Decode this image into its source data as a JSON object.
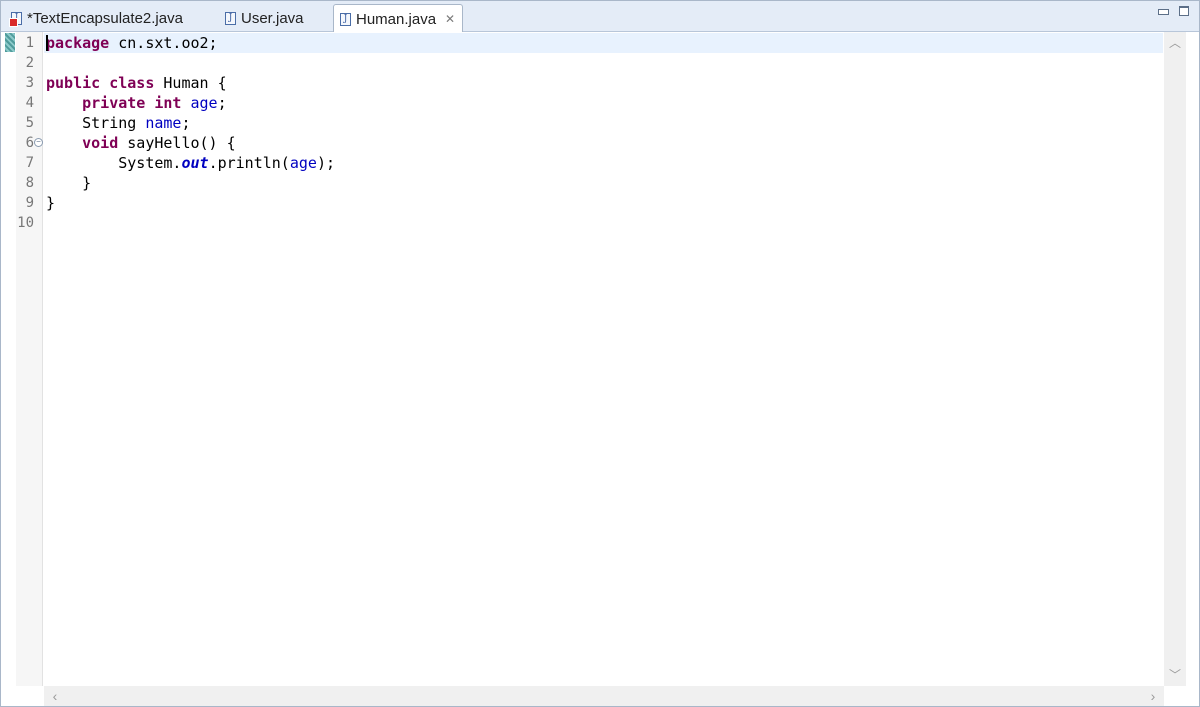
{
  "tabs": [
    {
      "label": "*TextEncapsulate2.java",
      "icon": "java-file-error-icon",
      "active": false
    },
    {
      "label": "User.java",
      "icon": "java-file-icon",
      "active": false
    },
    {
      "label": "Human.java",
      "icon": "java-file-icon",
      "active": true
    }
  ],
  "line_numbers": [
    "1",
    "2",
    "3",
    "4",
    "5",
    "6",
    "7",
    "8",
    "9",
    "10"
  ],
  "code": {
    "l1": {
      "kw": "package",
      "rest": " cn.sxt.oo2;"
    },
    "l3": {
      "kw1": "public",
      "kw2": "class",
      "rest": " Human {"
    },
    "l4": {
      "kw1": "private",
      "kw2": "int",
      "field": "age",
      "rest": ";"
    },
    "l5": {
      "type": "String ",
      "field": "name",
      "rest": ";"
    },
    "l6": {
      "kw": "void",
      "rest": " sayHello() {"
    },
    "l7": {
      "cls": "System.",
      "sfield": "out",
      "call": ".println(",
      "field": "age",
      "rest": ");"
    },
    "l8": {
      "text": "}"
    },
    "l9": {
      "text": "}"
    }
  },
  "icons": {
    "close": "close-icon",
    "fold": "fold-collapse-icon",
    "minimize": "minimize-icon",
    "maximize": "maximize-icon",
    "scroll_up": "chevron-up-icon",
    "scroll_down": "chevron-down-icon",
    "scroll_left": "chevron-left-icon",
    "scroll_right": "chevron-right-icon"
  },
  "colors": {
    "keyword": "#7f0055",
    "field": "#0000c0",
    "current_line": "#e8f2fe",
    "tabbar": "#e4ecf7"
  }
}
